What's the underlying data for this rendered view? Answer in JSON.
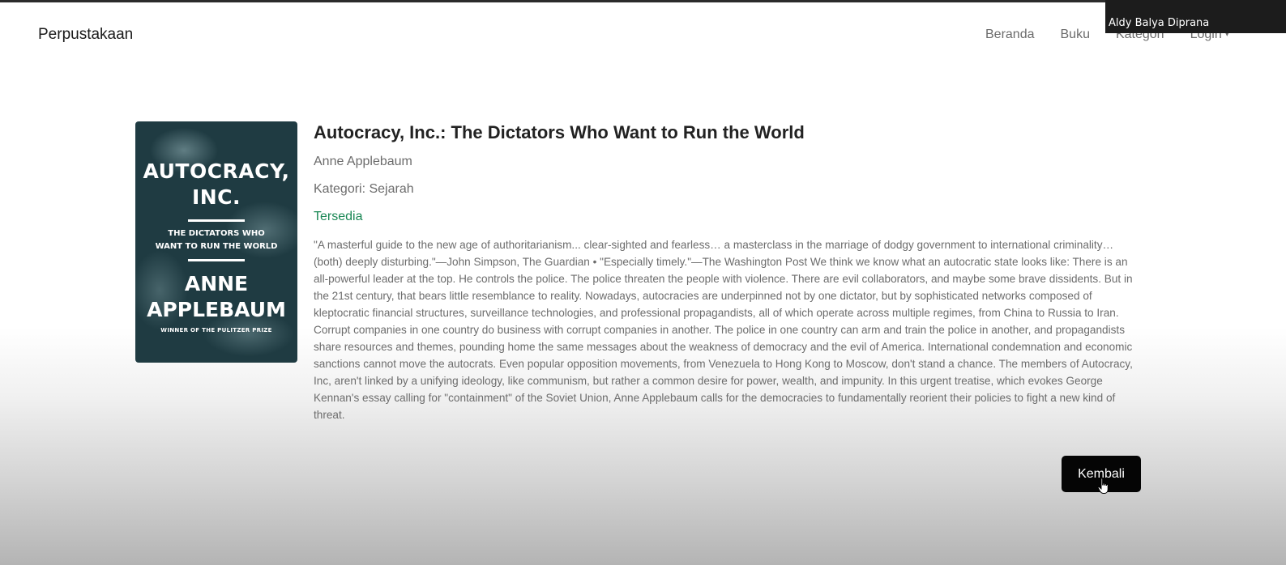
{
  "overlay": {
    "user_name": "Aldy Balya Diprana"
  },
  "navbar": {
    "brand": "Perpustakaan",
    "links": [
      "Beranda",
      "Buku",
      "Kategori",
      "Login"
    ]
  },
  "cover": {
    "title_line1": "AUTOCRACY,",
    "title_line2": "INC.",
    "subtitle_line1": "THE DICTATORS WHO",
    "subtitle_line2": "WANT TO RUN THE WORLD",
    "author_line1": "ANNE",
    "author_line2": "APPLEBAUM",
    "prize": "WINNER OF THE PULITZER PRIZE",
    "background_color": "#1f3b42"
  },
  "book": {
    "title": "Autocracy, Inc.: The Dictators Who Want to Run the World",
    "author": "Anne Applebaum",
    "category": "Kategori: Sejarah",
    "status": "Tersedia",
    "status_color": "#198754",
    "description": "\"A masterful guide to the new age of authoritarianism... clear-sighted and fearless… a masterclass in the marriage of dodgy government to international criminality… (both) deeply disturbing.\"—John Simpson, The Guardian • \"Especially timely.\"—The Washington Post We think we know what an autocratic state looks like: There is an all-powerful leader at the top. He controls the police. The police threaten the people with violence. There are evil collaborators, and maybe some brave dissidents. But in the 21st century, that bears little resemblance to reality. Nowadays, autocracies are underpinned not by one dictator, but by sophisticated networks composed of kleptocratic financial structures, surveillance technologies, and professional propagandists, all of which operate across multiple regimes, from China to Russia to Iran. Corrupt companies in one country do business with corrupt companies in another. The police in one country can arm and train the police in another, and propagandists share resources and themes, pounding home the same messages about the weakness of democracy and the evil of America. International condemnation and economic sanctions cannot move the autocrats. Even popular opposition movements, from Venezuela to Hong Kong to Moscow, don't stand a chance. The members of Autocracy, Inc, aren't linked by a unifying ideology, like communism, but rather a common desire for power, wealth, and impunity. In this urgent treatise, which evokes George Kennan's essay calling for \"containment\" of the Soviet Union, Anne Applebaum calls for the democracies to fundamentally reorient their policies to fight a new kind of threat."
  },
  "actions": {
    "back_label": "Kembali"
  },
  "icons": {
    "cursor": "hand-pointer-icon",
    "dropdown": "caret-down-icon"
  }
}
